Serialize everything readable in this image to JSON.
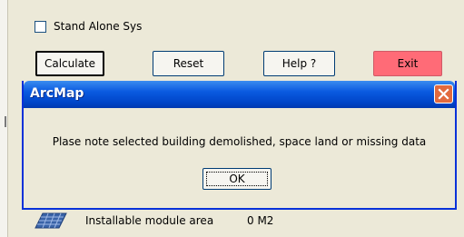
{
  "form": {
    "stand_alone_label": "Stand Alone Sys",
    "buttons": {
      "calculate": "Calculate",
      "reset": "Reset",
      "help": "Help ?",
      "exit": "Exit"
    },
    "module_area_label": "Installable module area",
    "module_area_value": "0 M2"
  },
  "dialog": {
    "title": "ArcMap",
    "message": "Plase note selected building demolished, space land or missing data",
    "ok_label": "OK"
  },
  "colors": {
    "exit_button": "#ff6b77",
    "titlebar": "#0a5ae0",
    "close_button": "#e26a3e"
  }
}
